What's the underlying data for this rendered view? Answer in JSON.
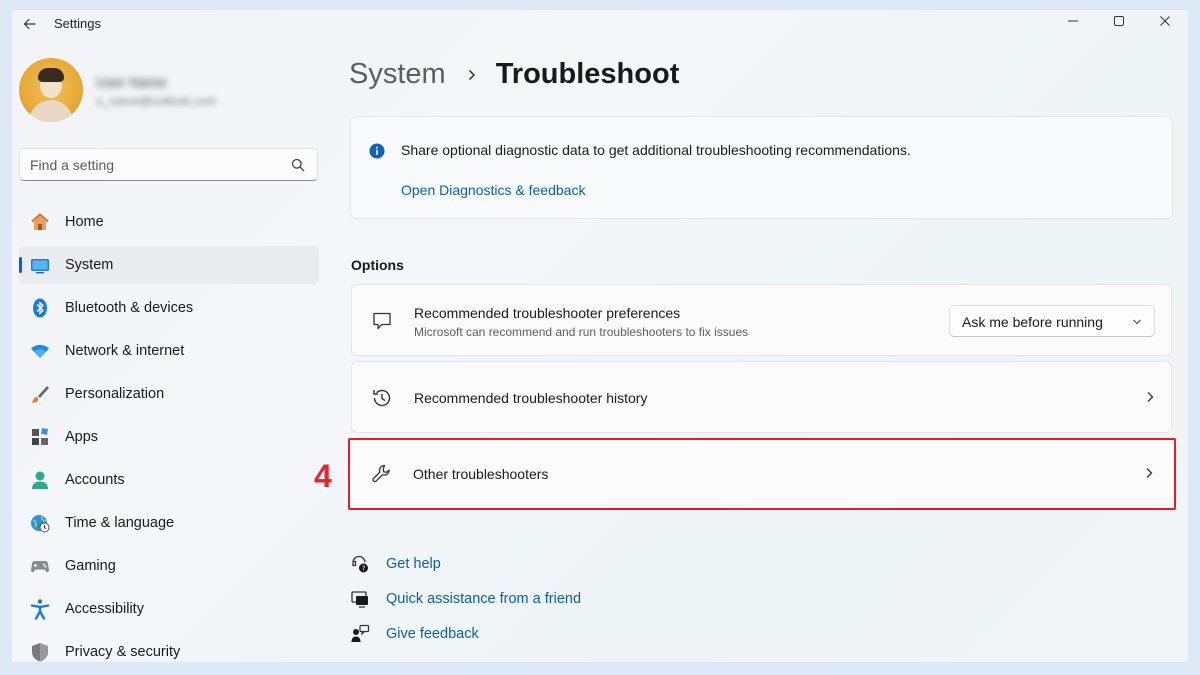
{
  "window": {
    "title": "Settings"
  },
  "profile": {
    "name": "User Name",
    "email": "u_name@outlook.com"
  },
  "search": {
    "placeholder": "Find a setting"
  },
  "nav": {
    "items": [
      {
        "label": "Home",
        "icon": "home-icon"
      },
      {
        "label": "System",
        "icon": "system-icon",
        "active": true
      },
      {
        "label": "Bluetooth & devices",
        "icon": "bluetooth-icon"
      },
      {
        "label": "Network & internet",
        "icon": "wifi-icon"
      },
      {
        "label": "Personalization",
        "icon": "brush-icon"
      },
      {
        "label": "Apps",
        "icon": "apps-icon"
      },
      {
        "label": "Accounts",
        "icon": "accounts-icon"
      },
      {
        "label": "Time & language",
        "icon": "globe-clock-icon"
      },
      {
        "label": "Gaming",
        "icon": "gamepad-icon"
      },
      {
        "label": "Accessibility",
        "icon": "accessibility-icon"
      },
      {
        "label": "Privacy & security",
        "icon": "shield-icon"
      }
    ]
  },
  "breadcrumb": {
    "parent": "System",
    "current": "Troubleshoot"
  },
  "info_card": {
    "text": "Share optional diagnostic data to get additional troubleshooting recommendations.",
    "link": "Open Diagnostics & feedback"
  },
  "options": {
    "label": "Options",
    "rows": [
      {
        "title": "Recommended troubleshooter preferences",
        "subtitle": "Microsoft can recommend and run troubleshooters to fix issues",
        "dropdown_value": "Ask me before running"
      },
      {
        "title": "Recommended troubleshooter history"
      },
      {
        "title": "Other troubleshooters"
      }
    ]
  },
  "annotation": {
    "step_number": "4",
    "color": "#d9222a"
  },
  "help_links": [
    {
      "label": "Get help"
    },
    {
      "label": "Quick assistance from a friend"
    },
    {
      "label": "Give feedback"
    }
  ],
  "colors": {
    "accent": "#0067c0",
    "link": "#0a5fa8",
    "highlight": "#d9222a"
  }
}
